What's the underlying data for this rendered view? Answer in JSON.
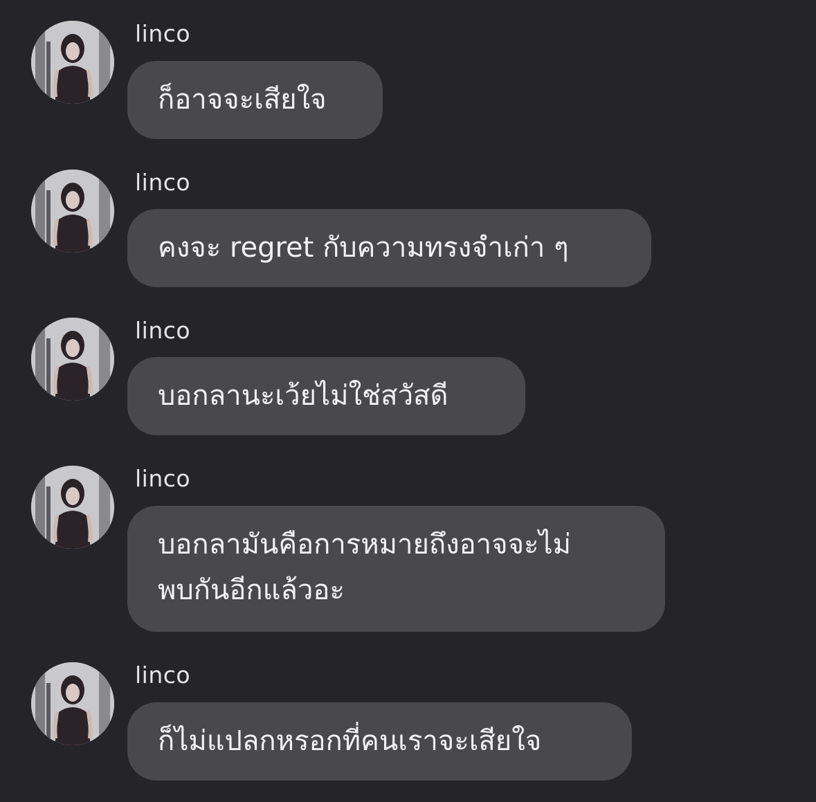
{
  "messages": [
    {
      "sender": "linco",
      "text": "ก็อาจจะเสียใจ",
      "avatar_icon": "profile-photo"
    },
    {
      "sender": "linco",
      "text": "คงจะ regret กับความทรงจำเก่า ๆ",
      "avatar_icon": "profile-photo"
    },
    {
      "sender": "linco",
      "text": "บอกลานะเว้ยไม่ใช่สวัสดี",
      "avatar_icon": "profile-photo"
    },
    {
      "sender": "linco",
      "text": "บอกลามันคือการหมายถึงอาจจะไม่\nพบกันอีกแล้วอะ",
      "avatar_icon": "profile-photo"
    },
    {
      "sender": "linco",
      "text": "ก็ไม่แปลกหรอกที่คนเราจะเสียใจ",
      "avatar_icon": "profile-photo"
    }
  ],
  "colors": {
    "background": "#242429",
    "bubble": "#48484d",
    "text": "#f2f2f5",
    "sender_text": "#e6e6ea"
  }
}
